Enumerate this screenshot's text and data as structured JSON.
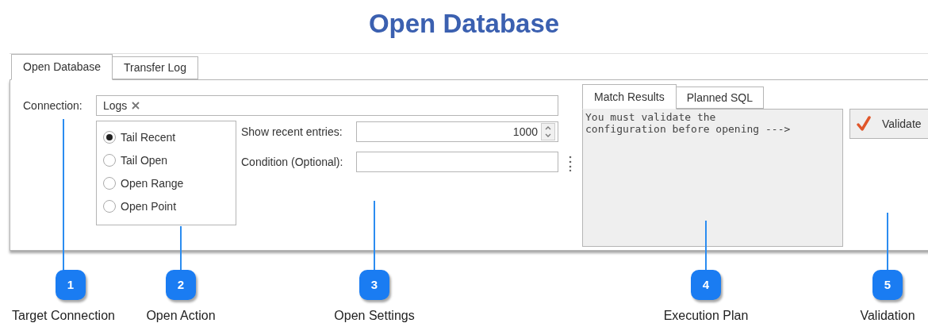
{
  "title": "Open Database",
  "tabs": [
    {
      "label": "Open Database",
      "selected": true
    },
    {
      "label": "Transfer Log",
      "selected": false
    }
  ],
  "connection": {
    "label": "Connection:",
    "value": "Logs"
  },
  "open_actions": [
    {
      "label": "Tail Recent",
      "selected": true
    },
    {
      "label": "Tail Open",
      "selected": false
    },
    {
      "label": "Open Range",
      "selected": false
    },
    {
      "label": "Open Point",
      "selected": false
    }
  ],
  "recent_entries": {
    "label": "Show recent entries:",
    "value": "1000"
  },
  "condition": {
    "label": "Condition (Optional):"
  },
  "result_tabs": [
    {
      "label": "Match Results",
      "selected": true
    },
    {
      "label": "Planned SQL",
      "selected": false
    }
  ],
  "result_text": [
    "You must validate the",
    "configuration before opening --->"
  ],
  "validate_button": "Validate",
  "callouts": [
    {
      "number": "1",
      "label": "Target Connection"
    },
    {
      "number": "2",
      "label": "Open Action"
    },
    {
      "number": "3",
      "label": "Open Settings"
    },
    {
      "number": "4",
      "label": "Execution Plan"
    },
    {
      "number": "5",
      "label": "Validation"
    }
  ]
}
